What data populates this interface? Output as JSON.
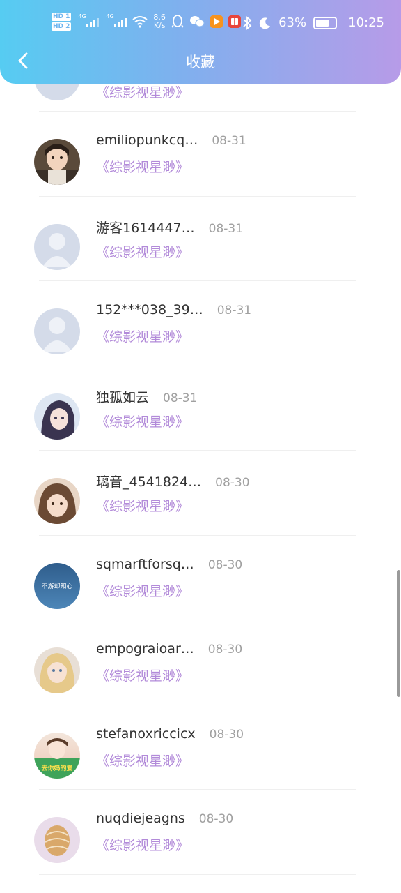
{
  "status_bar": {
    "hd1": "HD 1",
    "hd2": "HD 2",
    "net1": "4G",
    "net2": "4G",
    "speed_value": "8.6",
    "speed_unit": "K/s",
    "battery": "63%",
    "time": "10:25"
  },
  "header": {
    "title": "收藏"
  },
  "list": {
    "items": [
      {
        "name": "",
        "date": "",
        "book": "《综影视星渺》",
        "avatar": "default"
      },
      {
        "name": "emiliopunkcq…",
        "date": "08-31",
        "book": "《综影视星渺》",
        "avatar": "child"
      },
      {
        "name": "游客1614447…",
        "date": "08-31",
        "book": "《综影视星渺》",
        "avatar": "default"
      },
      {
        "name": "152***038_39…",
        "date": "08-31",
        "book": "《综影视星渺》",
        "avatar": "default"
      },
      {
        "name": "独孤如云",
        "date": "08-31",
        "book": "《综影视星渺》",
        "avatar": "anime-girl"
      },
      {
        "name": "璃音_4541824…",
        "date": "08-30",
        "book": "《综影视星渺》",
        "avatar": "girl-portrait"
      },
      {
        "name": "sqmarftforsq…",
        "date": "08-30",
        "book": "《综影视星渺》",
        "avatar": "blue-sky",
        "avatar_text": "不游却知心"
      },
      {
        "name": "empograioar…",
        "date": "08-30",
        "book": "《综影视星渺》",
        "avatar": "blonde-girl"
      },
      {
        "name": "stefanoxriccicx",
        "date": "08-30",
        "book": "《综影视星渺》",
        "avatar": "sticker-girl",
        "avatar_text": "去你妈的爱"
      },
      {
        "name": "nuqdiejeagns",
        "date": "08-30",
        "book": "《综影视星渺》",
        "avatar": "shell"
      }
    ]
  },
  "colors": {
    "header_start": "#56ccf2",
    "header_end": "#b79be8",
    "book_title": "#b28ad9",
    "date": "#a0a0a0"
  }
}
